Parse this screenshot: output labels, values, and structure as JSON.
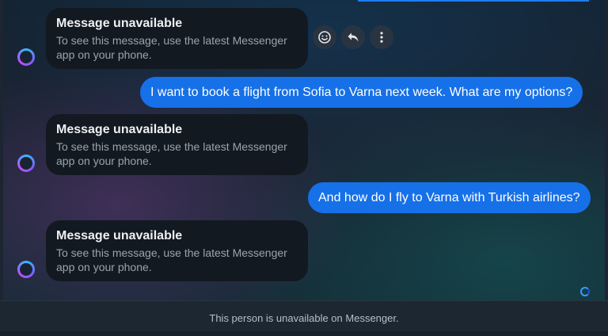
{
  "messages": [
    {
      "direction": "incoming",
      "title": "Message unavailable",
      "body": "To see this message, use the latest Messenger app on your phone."
    },
    {
      "direction": "outgoing",
      "text": "I want to book a flight from Sofia to Varna next week. What are my options?"
    },
    {
      "direction": "incoming",
      "title": "Message unavailable",
      "body": "To see this message, use the latest Messenger app on your phone."
    },
    {
      "direction": "outgoing",
      "text": "And how do I fly to Varna with Turkish airlines?"
    },
    {
      "direction": "incoming",
      "title": "Message unavailable",
      "body": "To see this message, use the latest Messenger app on your phone."
    }
  ],
  "hover_actions": [
    {
      "icon": "smiley-icon"
    },
    {
      "icon": "reply-icon"
    },
    {
      "icon": "more-vertical-icon"
    }
  ],
  "footer": {
    "notice": "This person is unavailable on Messenger."
  },
  "colors": {
    "outgoing_bubble": "#1670e8",
    "incoming_bubble": "#131920",
    "footer_bg": "#1d2732"
  }
}
